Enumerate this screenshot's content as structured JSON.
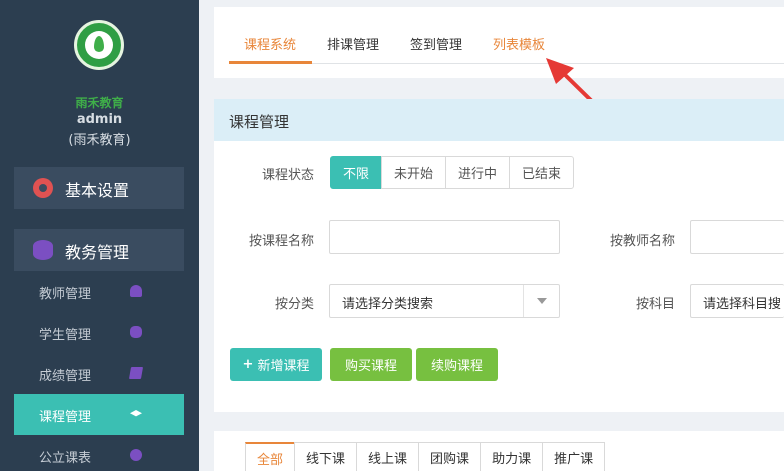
{
  "sidebar": {
    "org_name": "雨禾教育",
    "user_name": "admin",
    "user_org": "(雨禾教育)",
    "basic_settings": "基本设置",
    "academic": "教务管理",
    "items": [
      {
        "label": "教师管理"
      },
      {
        "label": "学生管理"
      },
      {
        "label": "成绩管理"
      },
      {
        "label": "课程管理"
      },
      {
        "label": "公立课表"
      }
    ]
  },
  "top_tabs": [
    "课程系统",
    "排课管理",
    "签到管理",
    "列表模板"
  ],
  "panel": {
    "title": "课程管理",
    "status_label": "课程状态",
    "status_options": [
      "不限",
      "未开始",
      "进行中",
      "已结束"
    ],
    "course_name_label": "按课程名称",
    "teacher_name_label": "按教师名称",
    "category_label": "按分类",
    "category_placeholder": "请选择分类搜索",
    "subject_label": "按科目",
    "subject_placeholder": "请选择科目搜",
    "add_course": "新增课程",
    "buy_course": "购买课程",
    "renew_course": "续购课程"
  },
  "bottom_tabs": [
    "全部",
    "线下课",
    "线上课",
    "团购课",
    "助力课",
    "推广课"
  ],
  "colors": {
    "sidebar_bg": "#2c3e50",
    "accent_teal": "#3bbfb3",
    "accent_orange": "#e8863a",
    "accent_green": "#77c040",
    "arrow_red": "#e53935"
  }
}
